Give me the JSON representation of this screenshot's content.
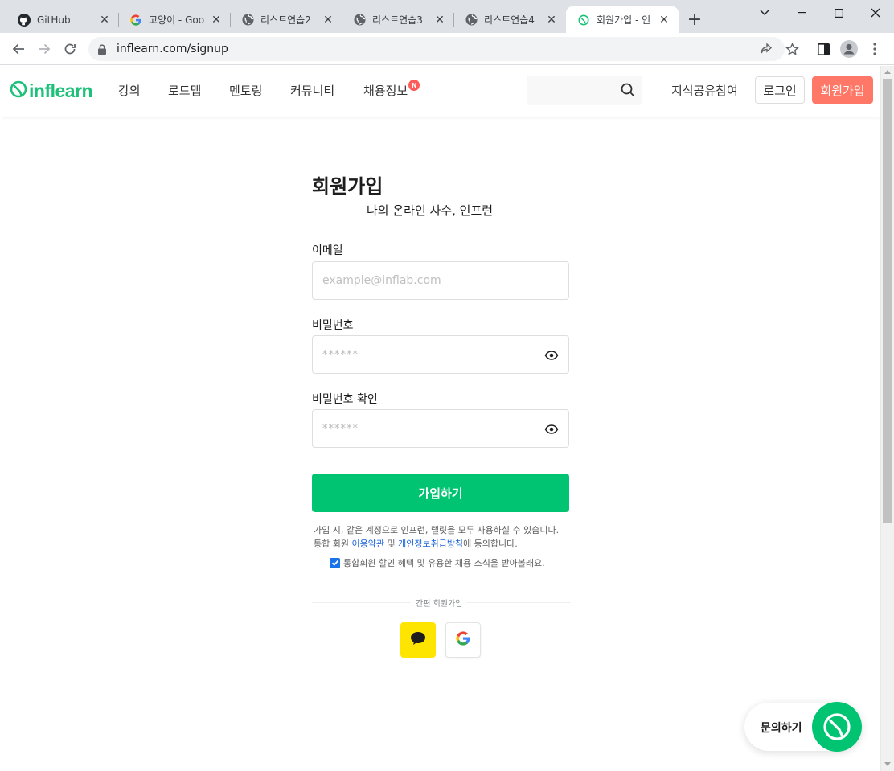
{
  "browser": {
    "tabs": [
      {
        "title": "GitHub",
        "icon": "github-icon"
      },
      {
        "title": "고양이 - Goo",
        "icon": "google-icon"
      },
      {
        "title": "리스트연습2",
        "icon": "globe-icon"
      },
      {
        "title": "리스트연습3",
        "icon": "globe-icon"
      },
      {
        "title": "리스트연습4",
        "icon": "globe-icon"
      },
      {
        "title": "회원가입 - 인",
        "icon": "inflearn-icon",
        "active": true
      }
    ],
    "url": "inflearn.com/signup"
  },
  "header": {
    "logo_text": "inflearn",
    "nav": [
      "강의",
      "로드맵",
      "멘토링",
      "커뮤니티",
      "채용정보"
    ],
    "nav_badge": "N",
    "share_link": "지식공유참여",
    "login": "로그인",
    "signup": "회원가입"
  },
  "form": {
    "title": "회원가입",
    "subtitle": "나의 온라인 사수, 인프런",
    "email_label": "이메일",
    "email_placeholder": "example@inflab.com",
    "password_label": "비밀번호",
    "password_placeholder": "******",
    "password_confirm_label": "비밀번호 확인",
    "password_confirm_placeholder": "******",
    "submit": "가입하기",
    "terms_line1": "가입 시, 같은 계정으로 인프런, 랠릿을 모두 사용하실 수 있습니다.",
    "terms_prefix": "통합 회원 ",
    "terms_link1": "이용약관",
    "terms_mid": " 및 ",
    "terms_link2": "개인정보취급방침",
    "terms_suffix": "에 동의합니다.",
    "agree_text": "통합회원 할인 혜택 및 유용한 채용 소식을 받아볼래요.",
    "agree_checked": true,
    "easy_signup_label": "간편 회원가입"
  },
  "inquiry": {
    "label": "문의하기"
  },
  "colors": {
    "brand": "#00c471",
    "signup_button": "#ff7867",
    "kakao": "#fee500",
    "link": "#1b64da"
  }
}
